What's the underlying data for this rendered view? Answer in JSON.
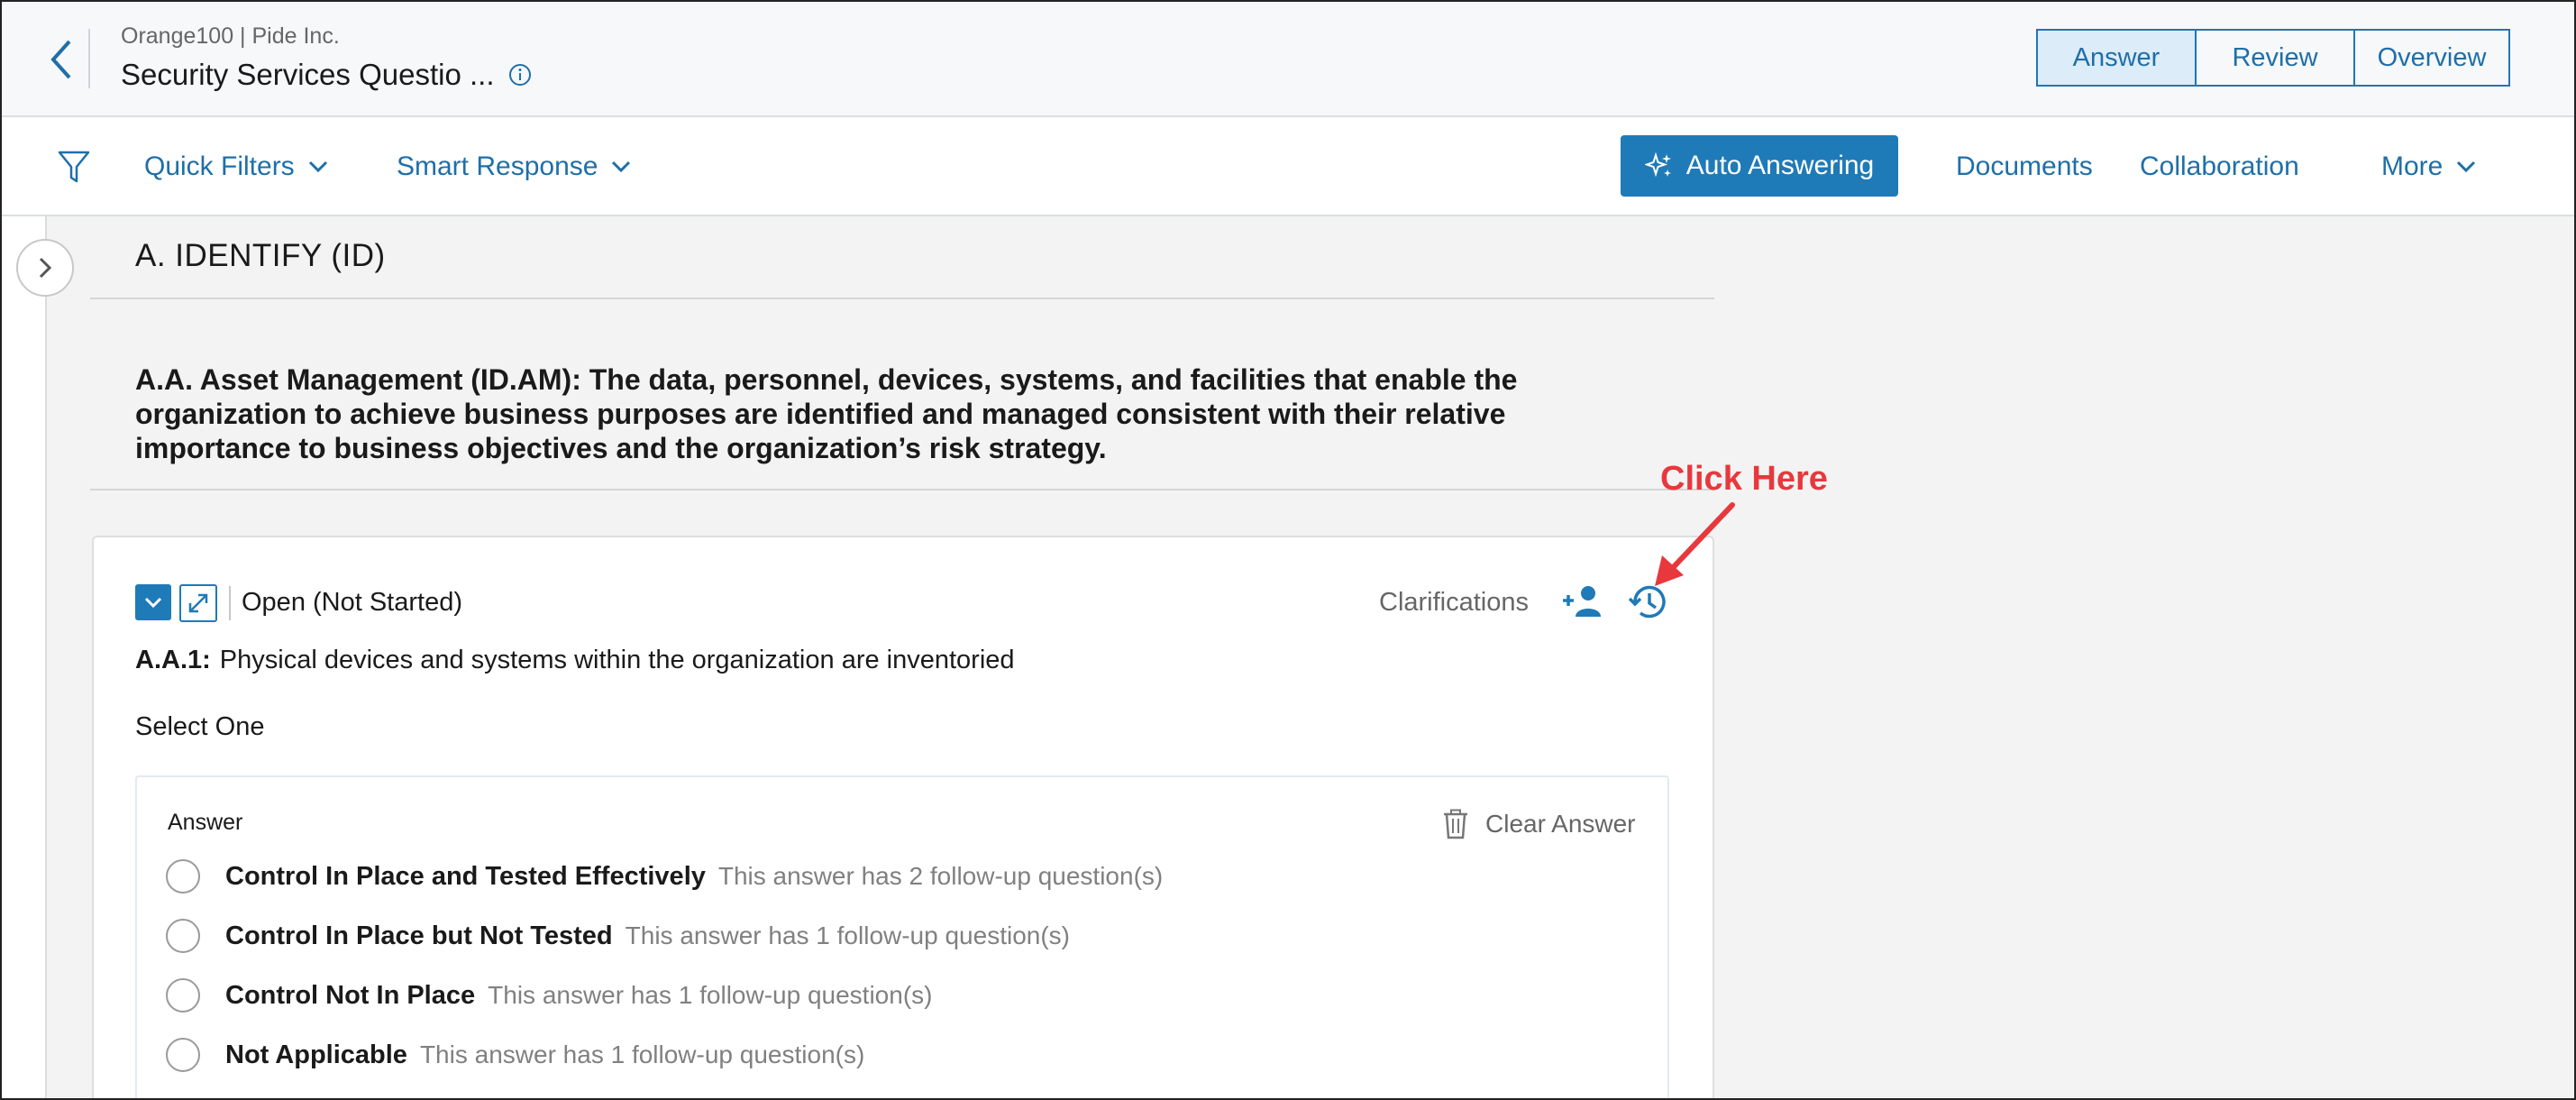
{
  "header": {
    "org": "Orange100 | Pide Inc.",
    "title": "Security Services Questio ...",
    "views": [
      "Answer",
      "Review",
      "Overview"
    ],
    "active_view": "Answer"
  },
  "toolbar": {
    "quick_filters": "Quick Filters",
    "smart_response": "Smart Response",
    "auto_answering": "Auto Answering",
    "documents": "Documents",
    "collaboration": "Collaboration",
    "more": "More"
  },
  "section": {
    "title": "A. IDENTIFY (ID)",
    "description": "A.A. Asset Management (ID.AM): The data, personnel, devices, systems, and facilities that enable the organization to achieve business purposes are identified and managed consistent with their relative importance to business objectives and the organization’s risk strategy."
  },
  "question": {
    "status": "Open (Not Started)",
    "clarifications": "Clarifications",
    "id": "A.A.1:",
    "text": "Physical devices and systems within the organization are inventoried",
    "select_hint": "Select One",
    "answer_label": "Answer",
    "clear_answer": "Clear Answer",
    "options": [
      {
        "label": "Control In Place and Tested Effectively",
        "note": "This answer has 2 follow-up question(s)"
      },
      {
        "label": "Control In Place but Not Tested",
        "note": "This answer has 1 follow-up question(s)"
      },
      {
        "label": "Control Not In Place",
        "note": "This answer has 1 follow-up question(s)"
      },
      {
        "label": "Not Applicable",
        "note": "This answer has 1 follow-up question(s)"
      }
    ]
  },
  "annotation": {
    "text": "Click Here"
  },
  "colors": {
    "brand_blue": "#1f7ab8",
    "annotation_red": "#e8383d"
  }
}
